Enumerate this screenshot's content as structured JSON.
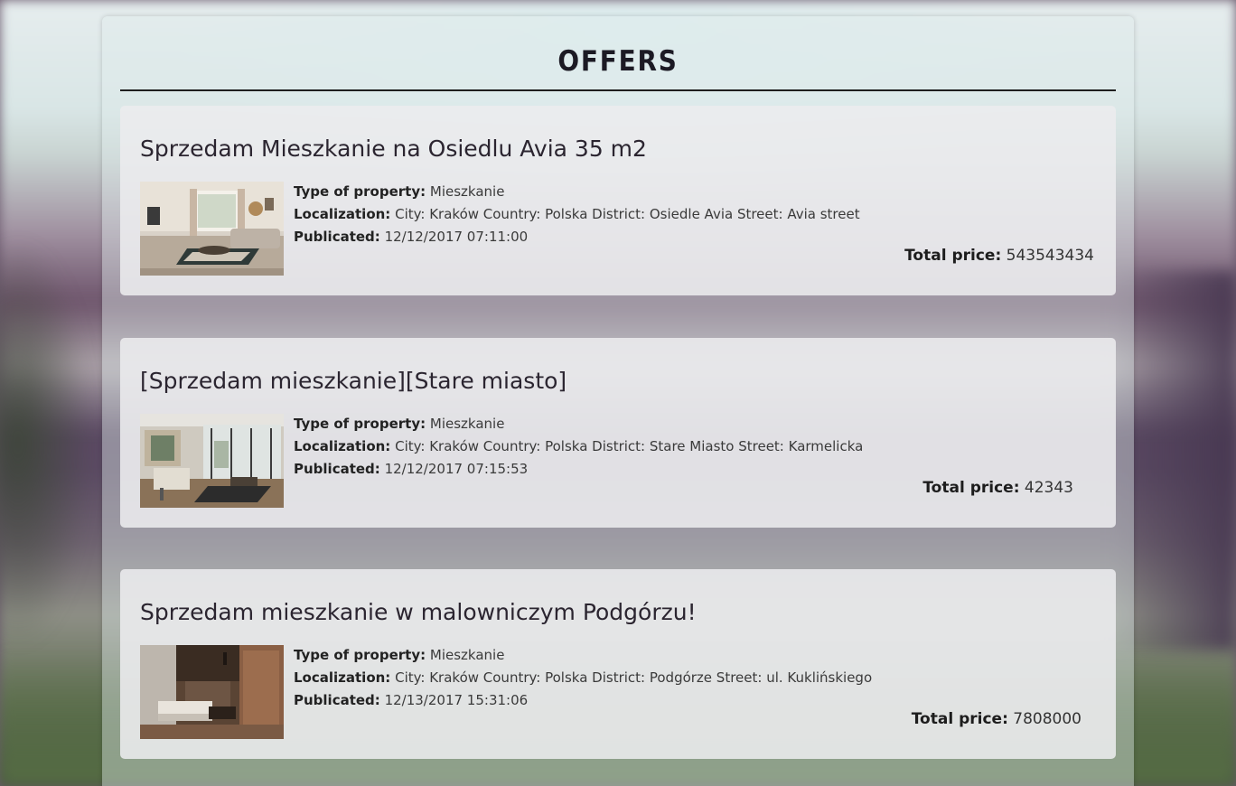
{
  "page": {
    "title": "OFFERS"
  },
  "labels": {
    "type_of_property": "Type of property:",
    "localization": "Localization:",
    "publicated": "Publicated:",
    "total_price": "Total price:"
  },
  "offers": [
    {
      "title": "Sprzedam Mieszkanie na Osiedlu Avia 35 m2",
      "type": "Mieszkanie",
      "localization": "City: Kraków Country: Polska District: Osiedle Avia Street: Avia street",
      "publicated": "12/12/2017 07:11:00",
      "price": "543543434",
      "thumbnail_icon": "living-room-photo"
    },
    {
      "title": "[Sprzedam mieszkanie][Stare miasto]",
      "type": "Mieszkanie",
      "localization": "City: Kraków Country: Polska District: Stare Miasto Street: Karmelicka",
      "publicated": "12/12/2017 07:15:53",
      "price": "42343",
      "thumbnail_icon": "apartment-interior-photo"
    },
    {
      "title": "Sprzedam mieszkanie w malowniczym Podgórzu!",
      "type": "Mieszkanie",
      "localization": "City: Kraków Country: Polska District: Podgórze Street: ul. Kuklińskiego",
      "publicated": "12/13/2017 15:31:06",
      "price": "7808000",
      "thumbnail_icon": "dark-interior-photo"
    }
  ]
}
